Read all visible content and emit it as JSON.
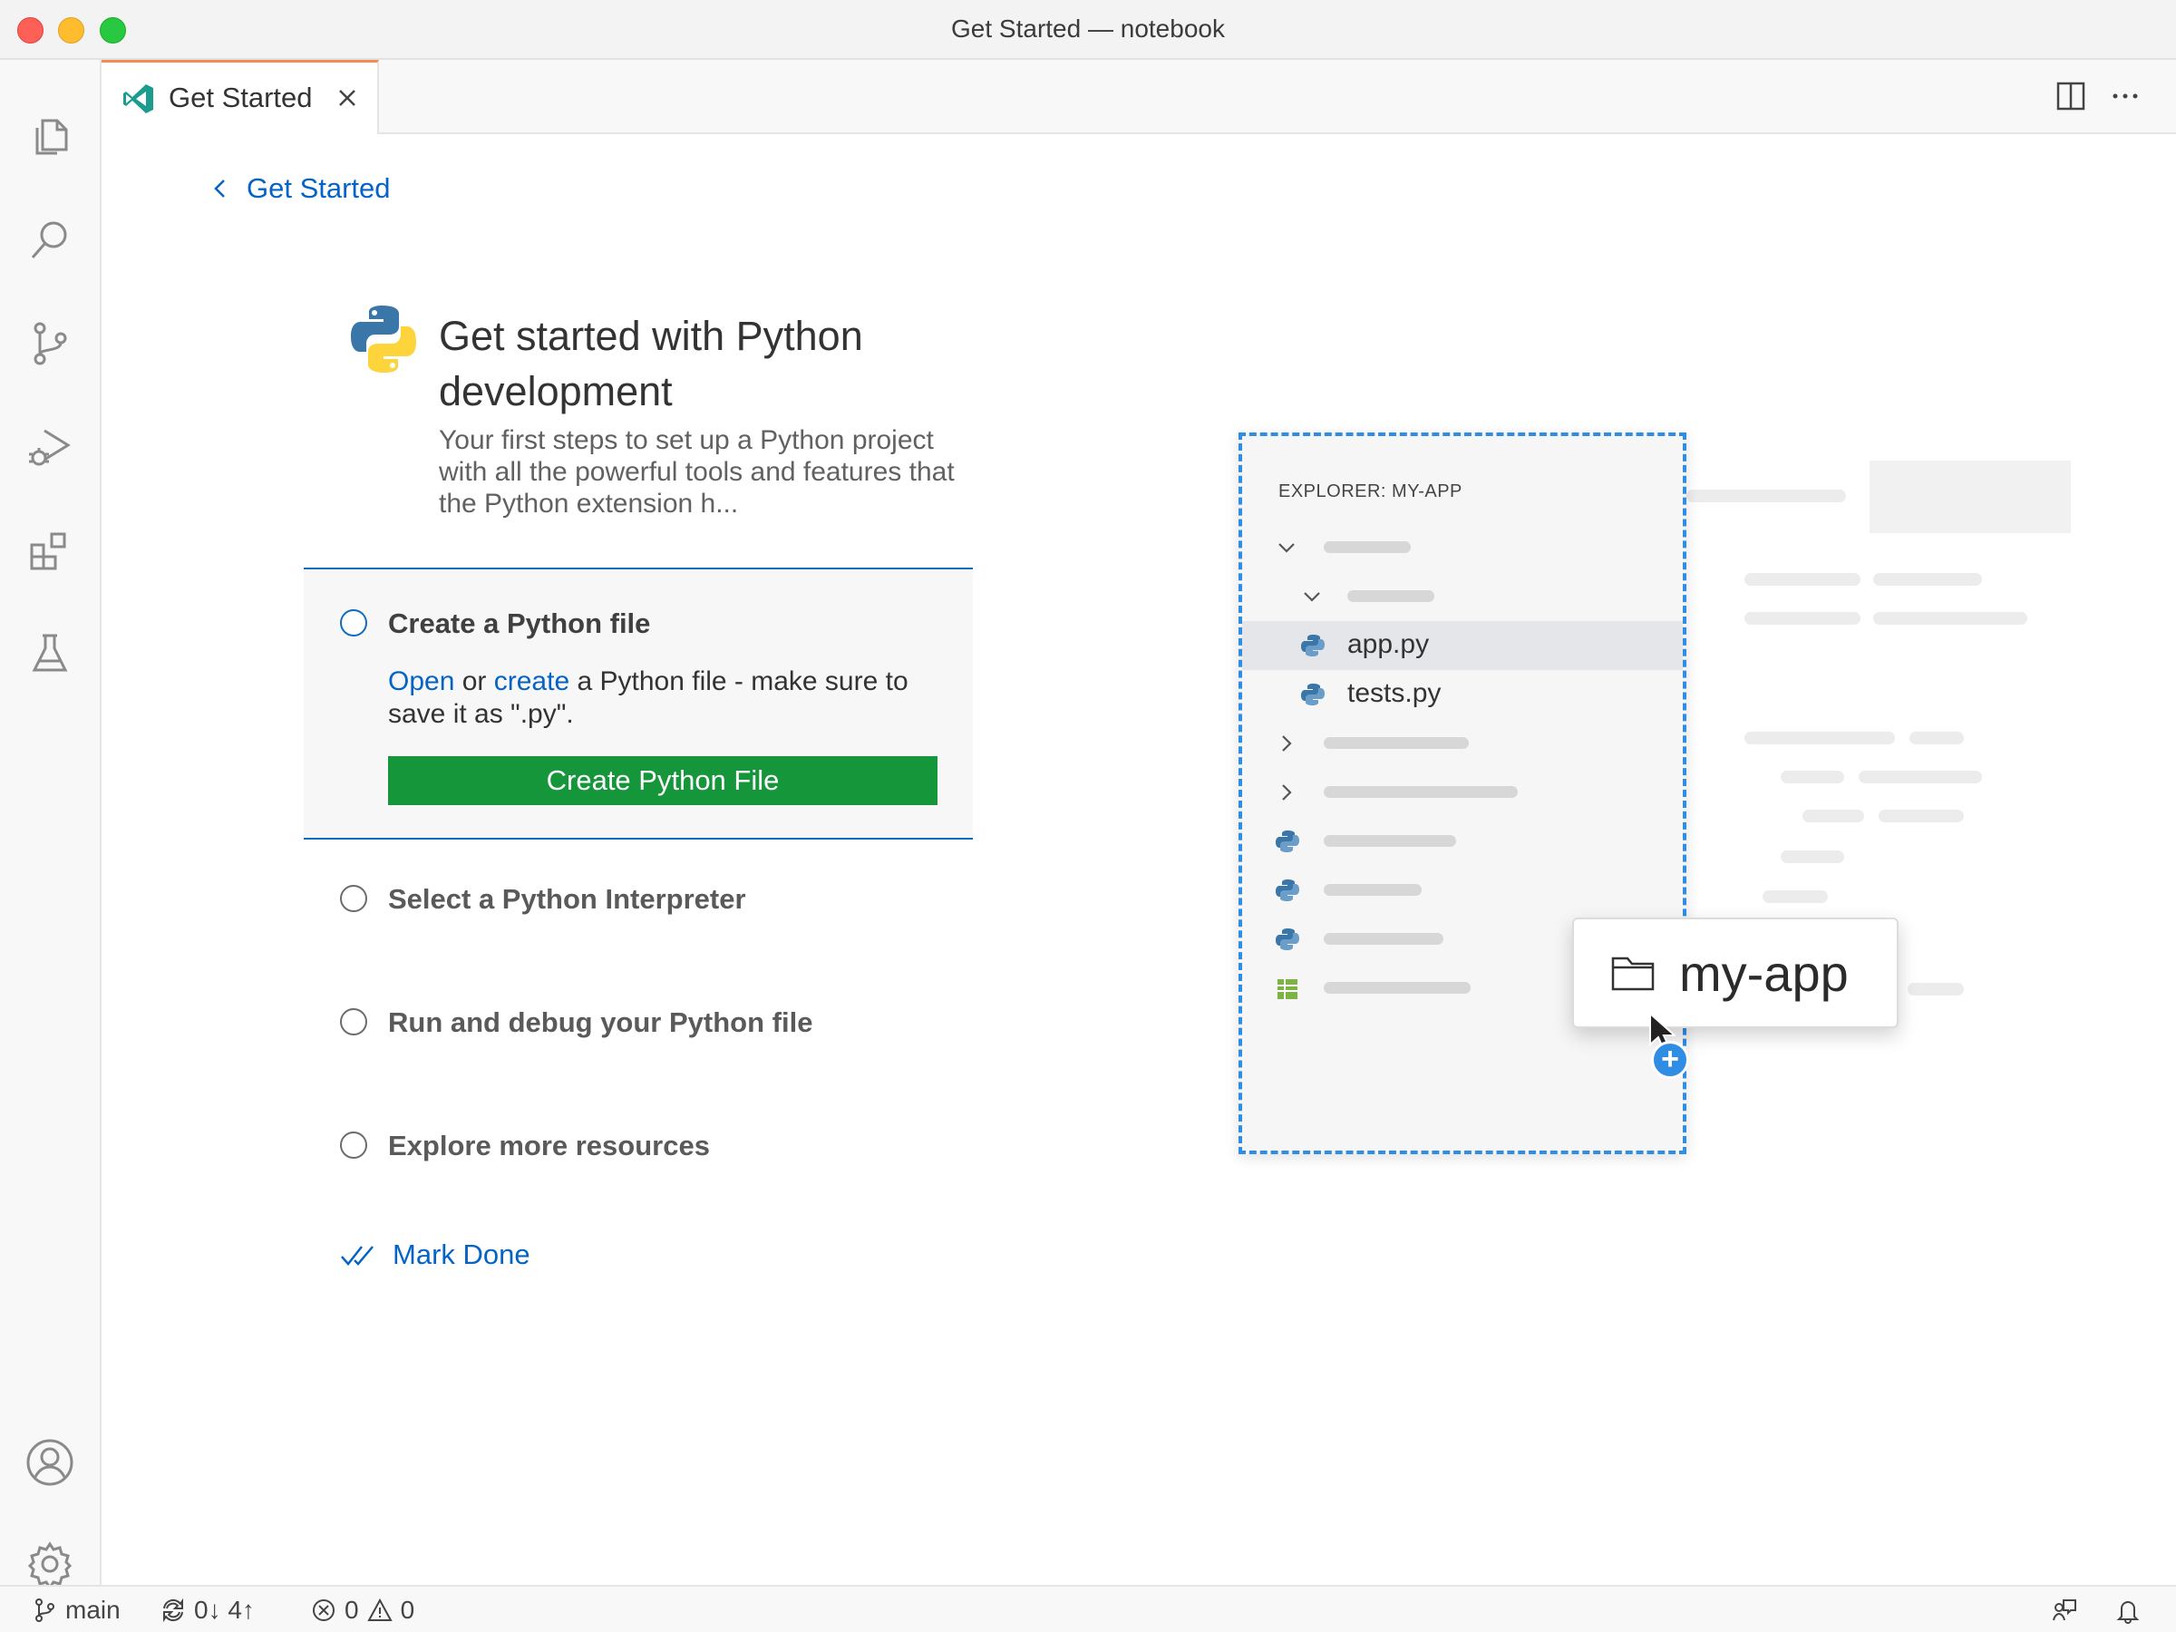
{
  "window": {
    "title": "Get Started — notebook"
  },
  "tab": {
    "label": "Get Started"
  },
  "editor": {
    "back_label": "Get Started",
    "heading": "Get started with Python development",
    "subtitle": "Your first steps to set up a Python project with all the powerful tools and features that the Python extension h...",
    "steps": [
      {
        "title": "Create a Python file",
        "desc_link_open": "Open",
        "desc_or": " or ",
        "desc_link_create": "create",
        "desc_rest": " a Python file - make sure to save it as \".py\".",
        "button": "Create Python File"
      },
      {
        "title": "Select a Python Interpreter"
      },
      {
        "title": "Run and debug your Python file"
      },
      {
        "title": "Explore more resources"
      }
    ],
    "mark_done": "Mark Done"
  },
  "illustration": {
    "explorer_title": "EXPLORER: MY-APP",
    "files": [
      "app.py",
      "tests.py"
    ],
    "drag_folder": "my-app",
    "plus": "+"
  },
  "statusbar": {
    "branch": "main",
    "sync": "0↓ 4↑",
    "errors": "0",
    "warnings": "0"
  },
  "colors": {
    "accent": "#0f6cbd",
    "link": "#0563c6",
    "primary_button": "#16963a",
    "tab_border": "#f28b54",
    "drop_outline": "#2f8de4"
  },
  "icons": {
    "activity": [
      "explorer-icon",
      "search-icon",
      "source-control-icon",
      "run-debug-icon",
      "extensions-icon",
      "testing-icon",
      "account-icon",
      "settings-gear-icon"
    ]
  }
}
